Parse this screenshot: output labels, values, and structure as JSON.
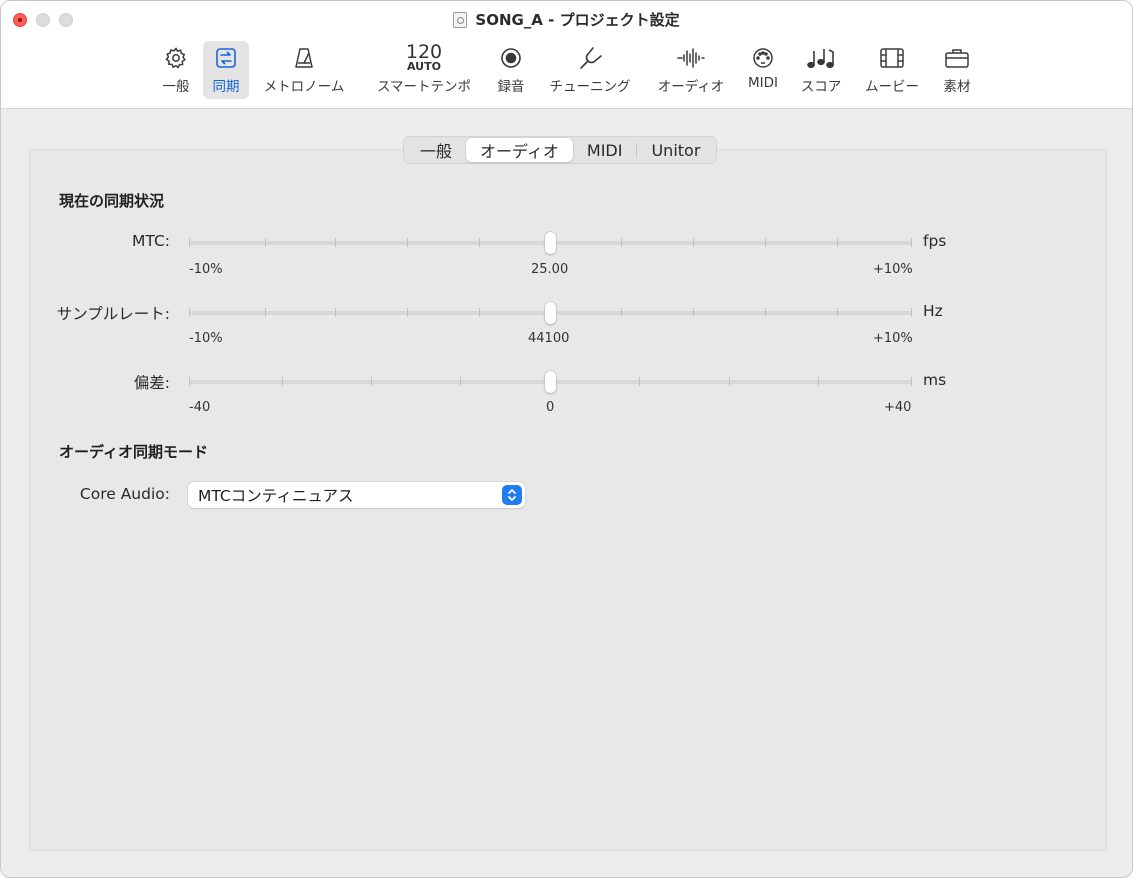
{
  "window": {
    "title": "SONG_A - プロジェクト設定"
  },
  "toolbar": {
    "items": [
      {
        "label": "一般",
        "icon": "gear-icon"
      },
      {
        "label": "同期",
        "icon": "sync-icon",
        "active": true
      },
      {
        "label": "メトロノーム",
        "icon": "metronome-icon"
      },
      {
        "label": "スマートテンポ",
        "icon": "tempo-icon",
        "tempo_value": "120",
        "tempo_mode": "AUTO"
      },
      {
        "label": "録音",
        "icon": "record-icon"
      },
      {
        "label": "チューニング",
        "icon": "tuning-fork-icon"
      },
      {
        "label": "オーディオ",
        "icon": "waveform-icon"
      },
      {
        "label": "MIDI",
        "icon": "midi-port-icon"
      },
      {
        "label": "スコア",
        "icon": "notes-icon"
      },
      {
        "label": "ムービー",
        "icon": "film-icon"
      },
      {
        "label": "素材",
        "icon": "briefcase-icon"
      }
    ]
  },
  "tabs": [
    {
      "label": "一般"
    },
    {
      "label": "オーディオ",
      "active": true
    },
    {
      "label": "MIDI"
    },
    {
      "label": "Unitor"
    }
  ],
  "sync_status": {
    "heading": "現在の同期状況",
    "rows": [
      {
        "label": "MTC:",
        "unit": "fps",
        "min_label": "-10%",
        "center_label": "25.00",
        "max_label": "+10%",
        "position": 0.5
      },
      {
        "label": "サンプルレート:",
        "unit": "Hz",
        "min_label": "-10%",
        "center_label": "44100",
        "max_label": "+10%",
        "position": 0.5
      },
      {
        "label": "偏差:",
        "unit": "ms",
        "min_label": "-40",
        "center_label": "0",
        "max_label": "+40",
        "position": 0.5
      }
    ]
  },
  "audio_sync_mode": {
    "heading": "オーディオ同期モード",
    "field_label": "Core Audio:",
    "selected_value": "MTCコンティニュアス"
  },
  "colors": {
    "accent": "#1f7cf3",
    "active_tab_text": "#1664d9",
    "close_button": "#ff5f57"
  }
}
